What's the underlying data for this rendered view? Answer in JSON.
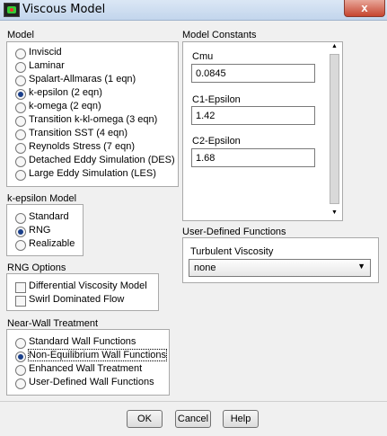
{
  "window": {
    "title": "Viscous Model",
    "close_label": "x"
  },
  "model": {
    "label": "Model",
    "options": [
      {
        "label": "Inviscid",
        "selected": false
      },
      {
        "label": "Laminar",
        "selected": false
      },
      {
        "label": "Spalart-Allmaras (1 eqn)",
        "selected": false
      },
      {
        "label": "k-epsilon (2 eqn)",
        "selected": true
      },
      {
        "label": "k-omega (2 eqn)",
        "selected": false
      },
      {
        "label": "Transition k-kl-omega (3 eqn)",
        "selected": false
      },
      {
        "label": "Transition SST (4 eqn)",
        "selected": false
      },
      {
        "label": "Reynolds Stress (7 eqn)",
        "selected": false
      },
      {
        "label": "Detached Eddy Simulation (DES)",
        "selected": false
      },
      {
        "label": "Large Eddy Simulation (LES)",
        "selected": false
      }
    ]
  },
  "ke_model": {
    "label": "k-epsilon Model",
    "options": [
      {
        "label": "Standard",
        "selected": false
      },
      {
        "label": "RNG",
        "selected": true
      },
      {
        "label": "Realizable",
        "selected": false
      }
    ]
  },
  "rng_options": {
    "label": "RNG Options",
    "options": [
      {
        "label": "Differential Viscosity Model",
        "checked": false
      },
      {
        "label": "Swirl Dominated Flow",
        "checked": false
      }
    ]
  },
  "near_wall": {
    "label": "Near-Wall Treatment",
    "options": [
      {
        "label": "Standard Wall Functions",
        "selected": false
      },
      {
        "label": "Non-Equilibrium Wall Functions",
        "selected": true
      },
      {
        "label": "Enhanced Wall Treatment",
        "selected": false
      },
      {
        "label": "User-Defined Wall Functions",
        "selected": false
      }
    ]
  },
  "constants": {
    "label": "Model Constants",
    "fields": [
      {
        "label": "Cmu",
        "value": "0.0845"
      },
      {
        "label": "C1-Epsilon",
        "value": "1.42"
      },
      {
        "label": "C2-Epsilon",
        "value": "1.68"
      }
    ]
  },
  "udf": {
    "label": "User-Defined Functions",
    "turbulent_viscosity_label": "Turbulent Viscosity",
    "turbulent_viscosity_value": "none"
  },
  "buttons": {
    "ok": "OK",
    "cancel": "Cancel",
    "help": "Help"
  }
}
